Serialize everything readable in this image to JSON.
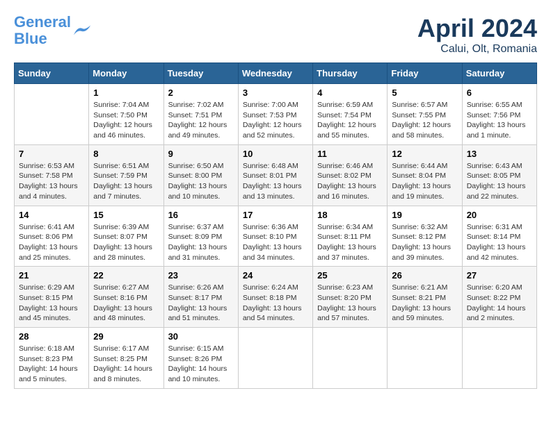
{
  "header": {
    "logo_line1": "General",
    "logo_line2": "Blue",
    "month_title": "April 2024",
    "location": "Calui, Olt, Romania"
  },
  "columns": [
    "Sunday",
    "Monday",
    "Tuesday",
    "Wednesday",
    "Thursday",
    "Friday",
    "Saturday"
  ],
  "weeks": [
    [
      {
        "num": "",
        "info": ""
      },
      {
        "num": "1",
        "info": "Sunrise: 7:04 AM\nSunset: 7:50 PM\nDaylight: 12 hours\nand 46 minutes."
      },
      {
        "num": "2",
        "info": "Sunrise: 7:02 AM\nSunset: 7:51 PM\nDaylight: 12 hours\nand 49 minutes."
      },
      {
        "num": "3",
        "info": "Sunrise: 7:00 AM\nSunset: 7:53 PM\nDaylight: 12 hours\nand 52 minutes."
      },
      {
        "num": "4",
        "info": "Sunrise: 6:59 AM\nSunset: 7:54 PM\nDaylight: 12 hours\nand 55 minutes."
      },
      {
        "num": "5",
        "info": "Sunrise: 6:57 AM\nSunset: 7:55 PM\nDaylight: 12 hours\nand 58 minutes."
      },
      {
        "num": "6",
        "info": "Sunrise: 6:55 AM\nSunset: 7:56 PM\nDaylight: 13 hours\nand 1 minute."
      }
    ],
    [
      {
        "num": "7",
        "info": "Sunrise: 6:53 AM\nSunset: 7:58 PM\nDaylight: 13 hours\nand 4 minutes."
      },
      {
        "num": "8",
        "info": "Sunrise: 6:51 AM\nSunset: 7:59 PM\nDaylight: 13 hours\nand 7 minutes."
      },
      {
        "num": "9",
        "info": "Sunrise: 6:50 AM\nSunset: 8:00 PM\nDaylight: 13 hours\nand 10 minutes."
      },
      {
        "num": "10",
        "info": "Sunrise: 6:48 AM\nSunset: 8:01 PM\nDaylight: 13 hours\nand 13 minutes."
      },
      {
        "num": "11",
        "info": "Sunrise: 6:46 AM\nSunset: 8:02 PM\nDaylight: 13 hours\nand 16 minutes."
      },
      {
        "num": "12",
        "info": "Sunrise: 6:44 AM\nSunset: 8:04 PM\nDaylight: 13 hours\nand 19 minutes."
      },
      {
        "num": "13",
        "info": "Sunrise: 6:43 AM\nSunset: 8:05 PM\nDaylight: 13 hours\nand 22 minutes."
      }
    ],
    [
      {
        "num": "14",
        "info": "Sunrise: 6:41 AM\nSunset: 8:06 PM\nDaylight: 13 hours\nand 25 minutes."
      },
      {
        "num": "15",
        "info": "Sunrise: 6:39 AM\nSunset: 8:07 PM\nDaylight: 13 hours\nand 28 minutes."
      },
      {
        "num": "16",
        "info": "Sunrise: 6:37 AM\nSunset: 8:09 PM\nDaylight: 13 hours\nand 31 minutes."
      },
      {
        "num": "17",
        "info": "Sunrise: 6:36 AM\nSunset: 8:10 PM\nDaylight: 13 hours\nand 34 minutes."
      },
      {
        "num": "18",
        "info": "Sunrise: 6:34 AM\nSunset: 8:11 PM\nDaylight: 13 hours\nand 37 minutes."
      },
      {
        "num": "19",
        "info": "Sunrise: 6:32 AM\nSunset: 8:12 PM\nDaylight: 13 hours\nand 39 minutes."
      },
      {
        "num": "20",
        "info": "Sunrise: 6:31 AM\nSunset: 8:14 PM\nDaylight: 13 hours\nand 42 minutes."
      }
    ],
    [
      {
        "num": "21",
        "info": "Sunrise: 6:29 AM\nSunset: 8:15 PM\nDaylight: 13 hours\nand 45 minutes."
      },
      {
        "num": "22",
        "info": "Sunrise: 6:27 AM\nSunset: 8:16 PM\nDaylight: 13 hours\nand 48 minutes."
      },
      {
        "num": "23",
        "info": "Sunrise: 6:26 AM\nSunset: 8:17 PM\nDaylight: 13 hours\nand 51 minutes."
      },
      {
        "num": "24",
        "info": "Sunrise: 6:24 AM\nSunset: 8:18 PM\nDaylight: 13 hours\nand 54 minutes."
      },
      {
        "num": "25",
        "info": "Sunrise: 6:23 AM\nSunset: 8:20 PM\nDaylight: 13 hours\nand 57 minutes."
      },
      {
        "num": "26",
        "info": "Sunrise: 6:21 AM\nSunset: 8:21 PM\nDaylight: 13 hours\nand 59 minutes."
      },
      {
        "num": "27",
        "info": "Sunrise: 6:20 AM\nSunset: 8:22 PM\nDaylight: 14 hours\nand 2 minutes."
      }
    ],
    [
      {
        "num": "28",
        "info": "Sunrise: 6:18 AM\nSunset: 8:23 PM\nDaylight: 14 hours\nand 5 minutes."
      },
      {
        "num": "29",
        "info": "Sunrise: 6:17 AM\nSunset: 8:25 PM\nDaylight: 14 hours\nand 8 minutes."
      },
      {
        "num": "30",
        "info": "Sunrise: 6:15 AM\nSunset: 8:26 PM\nDaylight: 14 hours\nand 10 minutes."
      },
      {
        "num": "",
        "info": ""
      },
      {
        "num": "",
        "info": ""
      },
      {
        "num": "",
        "info": ""
      },
      {
        "num": "",
        "info": ""
      }
    ]
  ]
}
